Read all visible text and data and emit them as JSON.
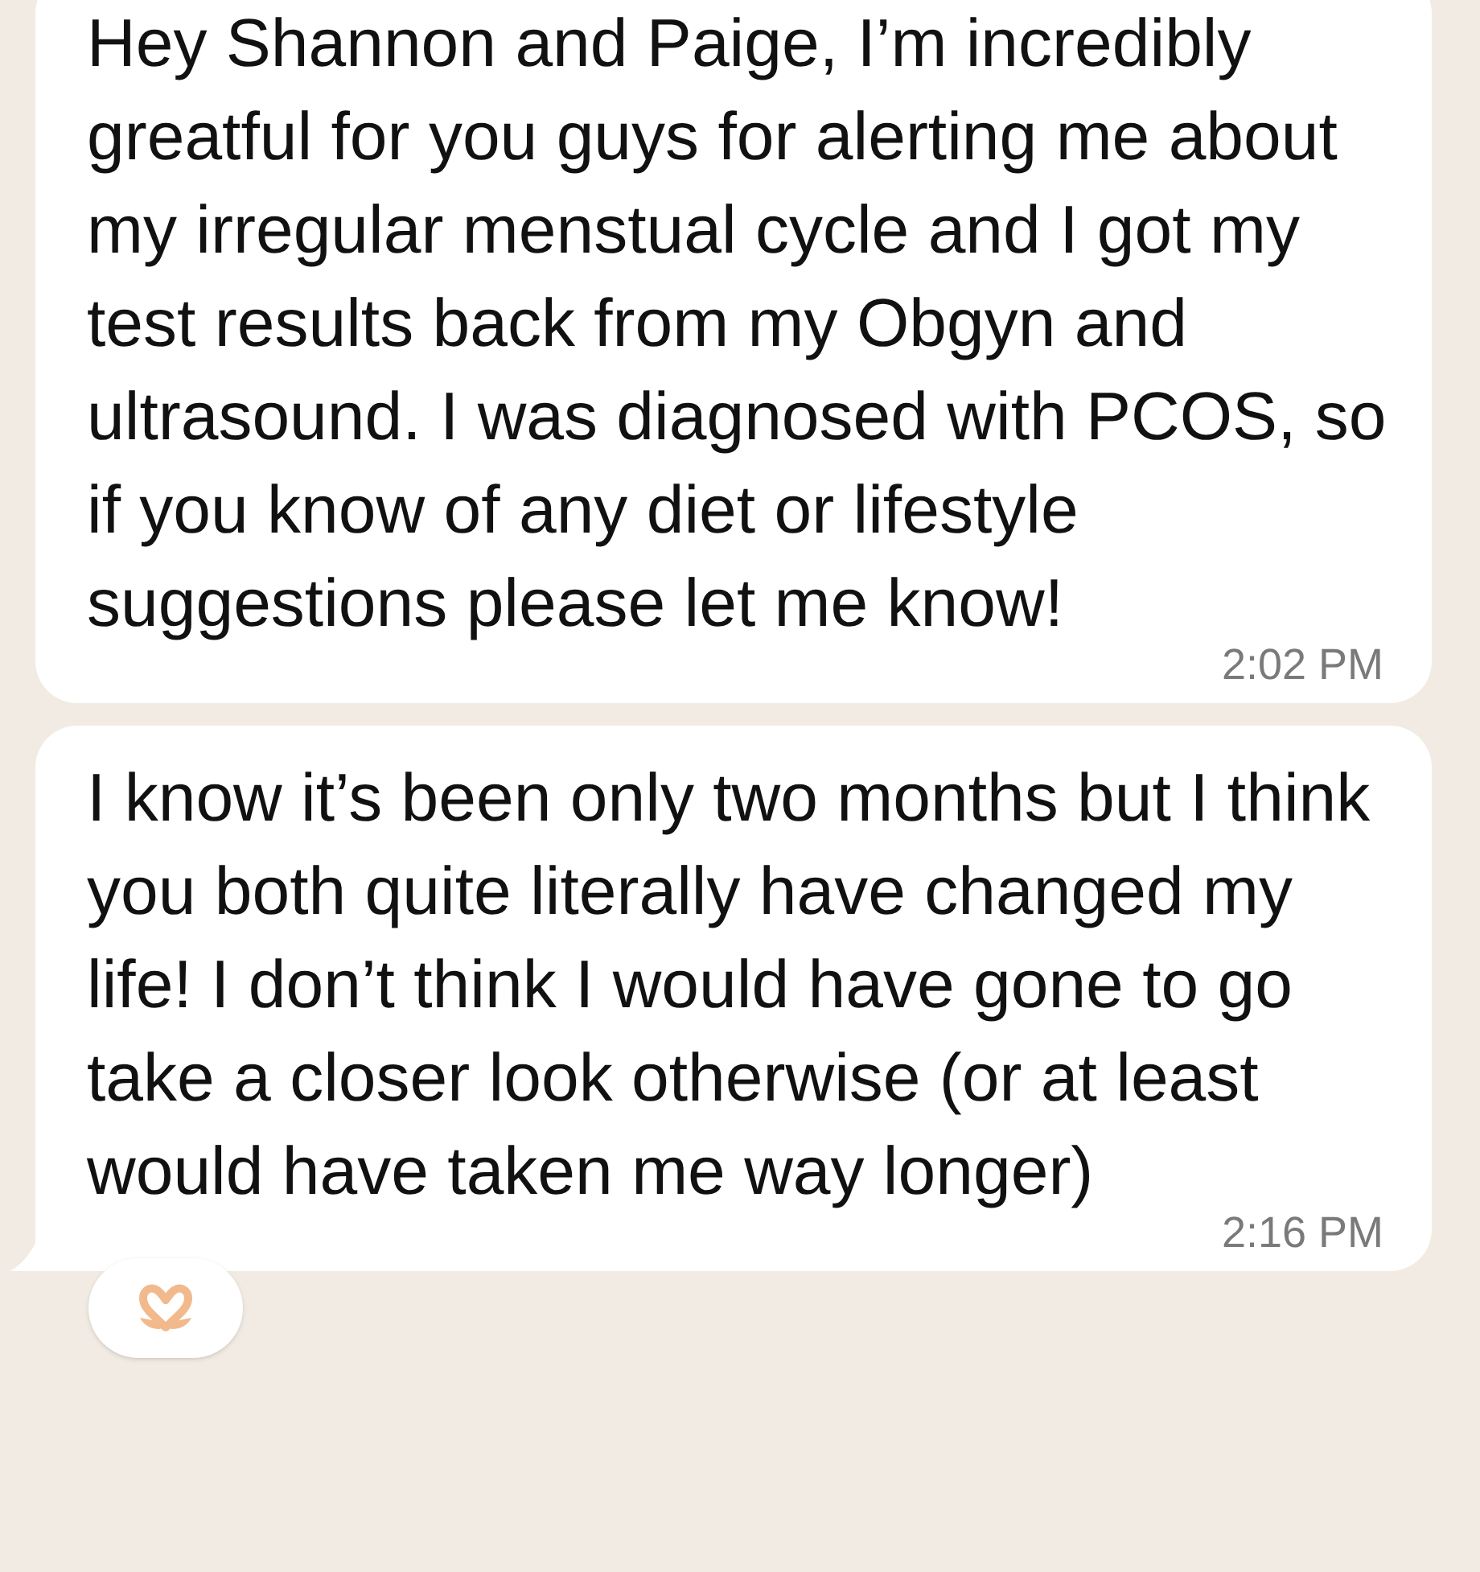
{
  "messages": [
    {
      "text": "Hey Shannon and Paige, I’m incredibly greatful for you guys for alerting me about my irregular menstual cycle and I got my test results back from my Obgyn and ultrasound. I was diagnosed with PCOS, so if you know of any diet or lifestyle suggestions please let me know!",
      "time": "2:02 PM",
      "tail": false,
      "reacted": false
    },
    {
      "text": "I know it’s been only two months but I think you both quite literally have changed my life! I don’t think I would have gone to go take a closer look otherwise (or at least would have taken me way longer)",
      "time": "2:16 PM",
      "tail": true,
      "reacted": true
    }
  ]
}
